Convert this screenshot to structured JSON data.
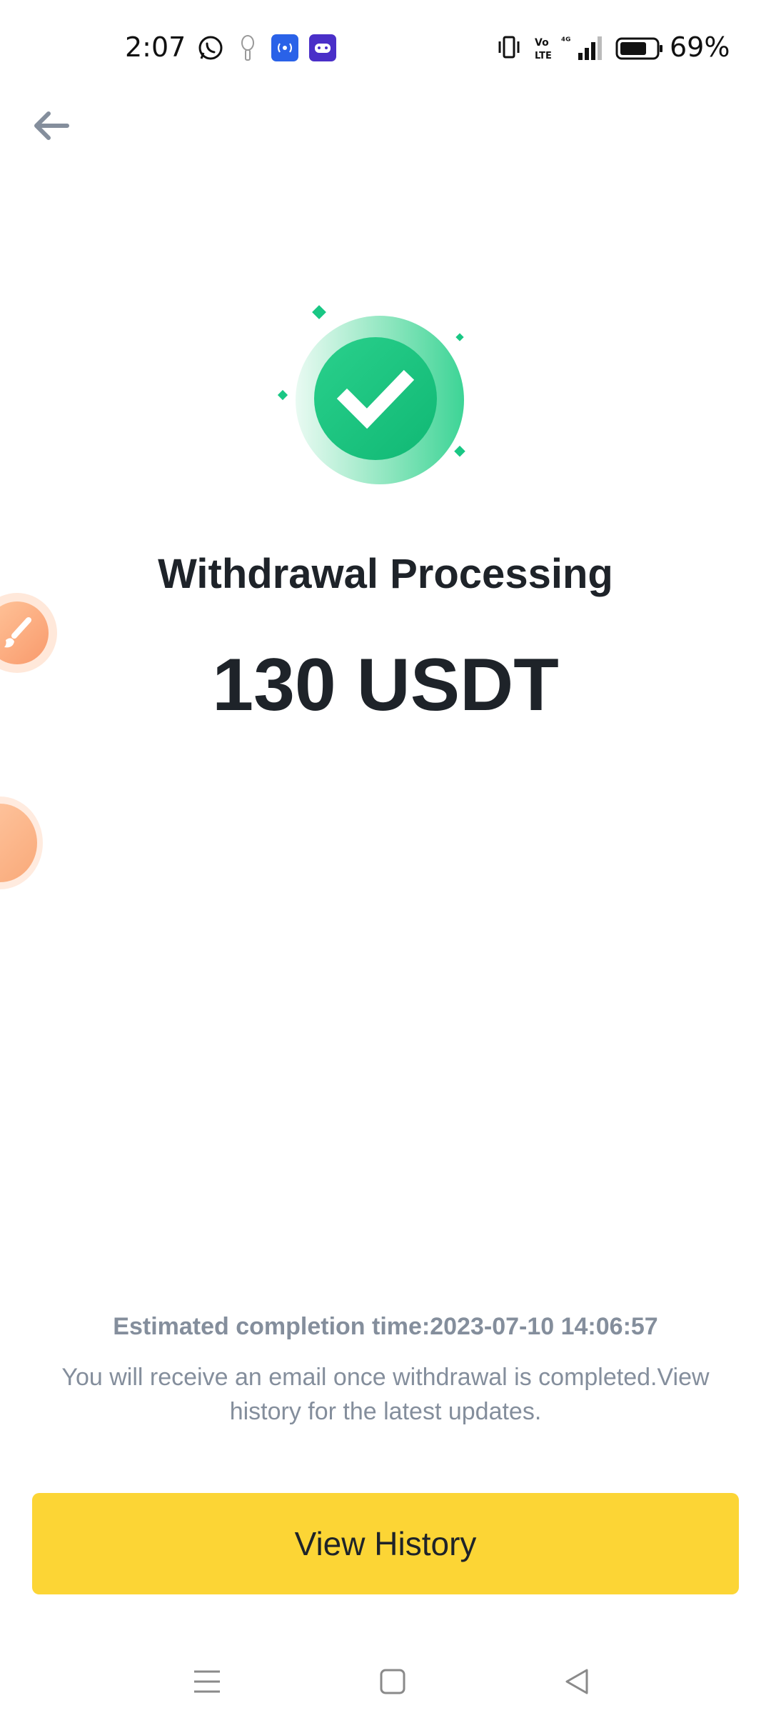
{
  "status_bar": {
    "time": "2:07",
    "battery_percent": "69%",
    "icons": [
      "whatsapp-icon",
      "pin-icon",
      "radio-app-icon",
      "game-app-icon",
      "vibrate-icon",
      "volte-icon",
      "signal-4g-icon",
      "battery-icon"
    ]
  },
  "header": {
    "back_icon": "arrow-left-icon"
  },
  "main": {
    "title": "Withdrawal Processing",
    "amount": "130 USDT",
    "status_icon": "check-circle-icon",
    "accent_color": "#19c784"
  },
  "footer": {
    "estimate": "Estimated completion time:2023-07-10 14:06:57",
    "notice": "You will receive an email once withdrawal is completed.View history for the latest updates.",
    "button_label": "View History",
    "button_color": "#fcd535"
  },
  "nav_bar": {
    "icons": [
      "menu-icon",
      "home-icon",
      "back-triangle-icon"
    ]
  }
}
